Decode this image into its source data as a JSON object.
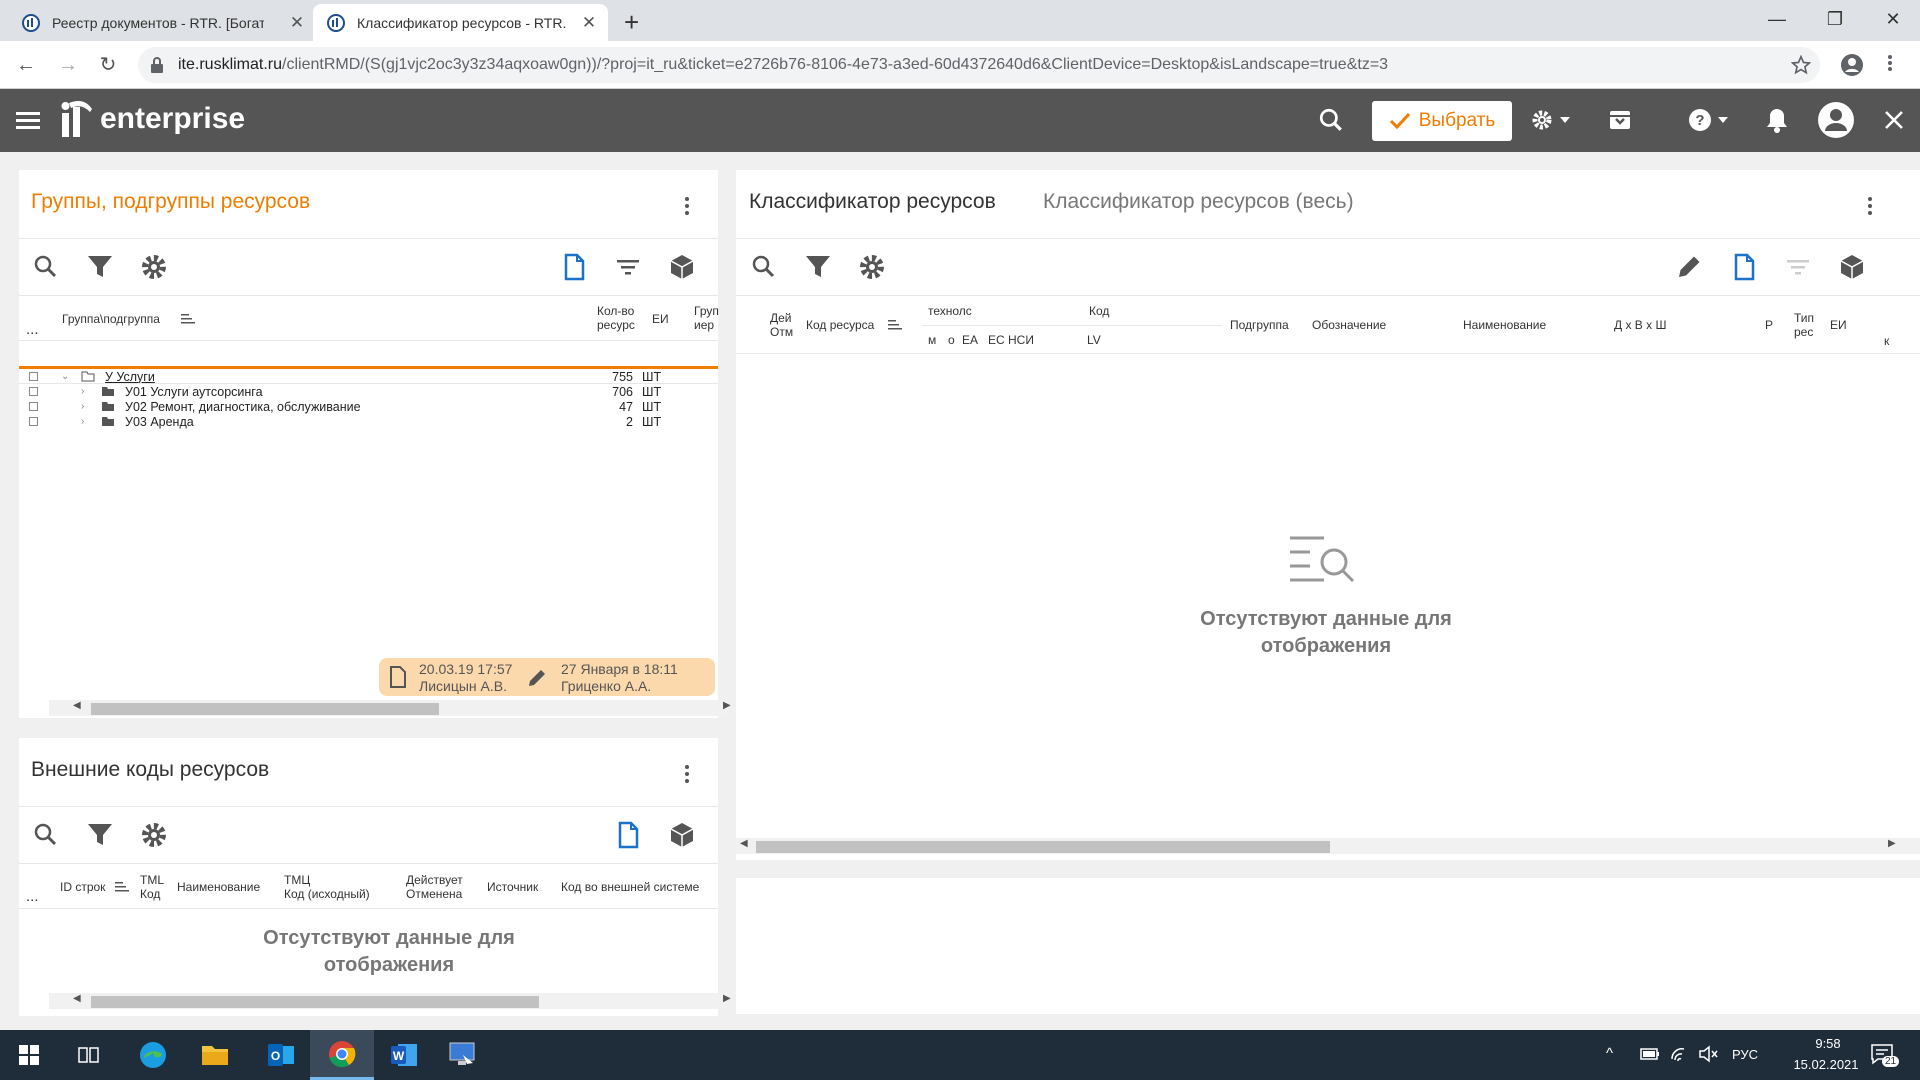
{
  "browser": {
    "tabs": [
      {
        "title": "Реестр документов - RTR. [Богат"
      },
      {
        "title": "Классификатор ресурсов - RTR."
      }
    ],
    "url_host": "ite.rusklimat.ru",
    "url_path": "/clientRMD/(S(gj1vjc2oc3y3z34aqxoaw0gn))/?proj=it_ru&ticket=e2726b76-8106-4e73-a3ed-60d4372640d6&ClientDevice=Desktop&isLandscape=true&tz=3"
  },
  "app": {
    "logo_text": "enterprise",
    "select_label": "Выбрать",
    "accent": "#f07d00"
  },
  "groups_panel": {
    "title": "Группы, подгруппы ресурсов",
    "col_group": "Группа\\подгруппа",
    "col_qty": "Кол-во\nресурс",
    "col_unit": "ЕИ",
    "col_hier": "Груп\nиер",
    "rows": [
      {
        "name": "У Услуги",
        "qty": "755",
        "unit": "ШТ"
      },
      {
        "name": "У01 Услуги аутсорсинга",
        "qty": "706",
        "unit": "ШТ"
      },
      {
        "name": "У02 Ремонт, диагностика, обслуживание",
        "qty": "47",
        "unit": "ШТ"
      },
      {
        "name": "У03 Аренда",
        "qty": "2",
        "unit": "ШТ"
      }
    ],
    "created": "20.03.19 17:57",
    "created_by": "Лисицын А.В.",
    "modified": "27 Января в 18:11",
    "modified_by": "Гриценко А.А."
  },
  "ext_panel": {
    "title": "Внешние коды ресурсов",
    "cols": [
      "ID строк",
      "TML\nКод",
      "Наименование",
      "ТМЦ\nКод (исходный)",
      "Действует\nОтменена",
      "Источник",
      "Код во внешней системе"
    ],
    "empty": "Отсутствуют данные для\nотображения"
  },
  "classifier_panel": {
    "tab1": "Классификатор ресурсов",
    "tab2": "Классификатор ресурсов (весь)",
    "col_act": "Дей\nОтм",
    "col_code": "Код ресурса",
    "col_tech": "технолс",
    "col_m": "м",
    "col_o": "о",
    "col_ea": "ЕА",
    "col_es": "ЕС НСИ",
    "col_kod": "Код",
    "col_lv": "LV",
    "col_sub": "Подгруппа",
    "col_des": "Обозначение",
    "col_name": "Наименование",
    "col_dim": "Д х В х Ш",
    "col_r": "Р",
    "col_type": "Тип\nрес",
    "col_unit": "ЕИ",
    "col_k": "к",
    "empty": "Отсутствуют данные для\nотображения"
  },
  "taskbar": {
    "lang": "РУС",
    "time": "9:58",
    "date": "15.02.2021",
    "notif": "21"
  }
}
